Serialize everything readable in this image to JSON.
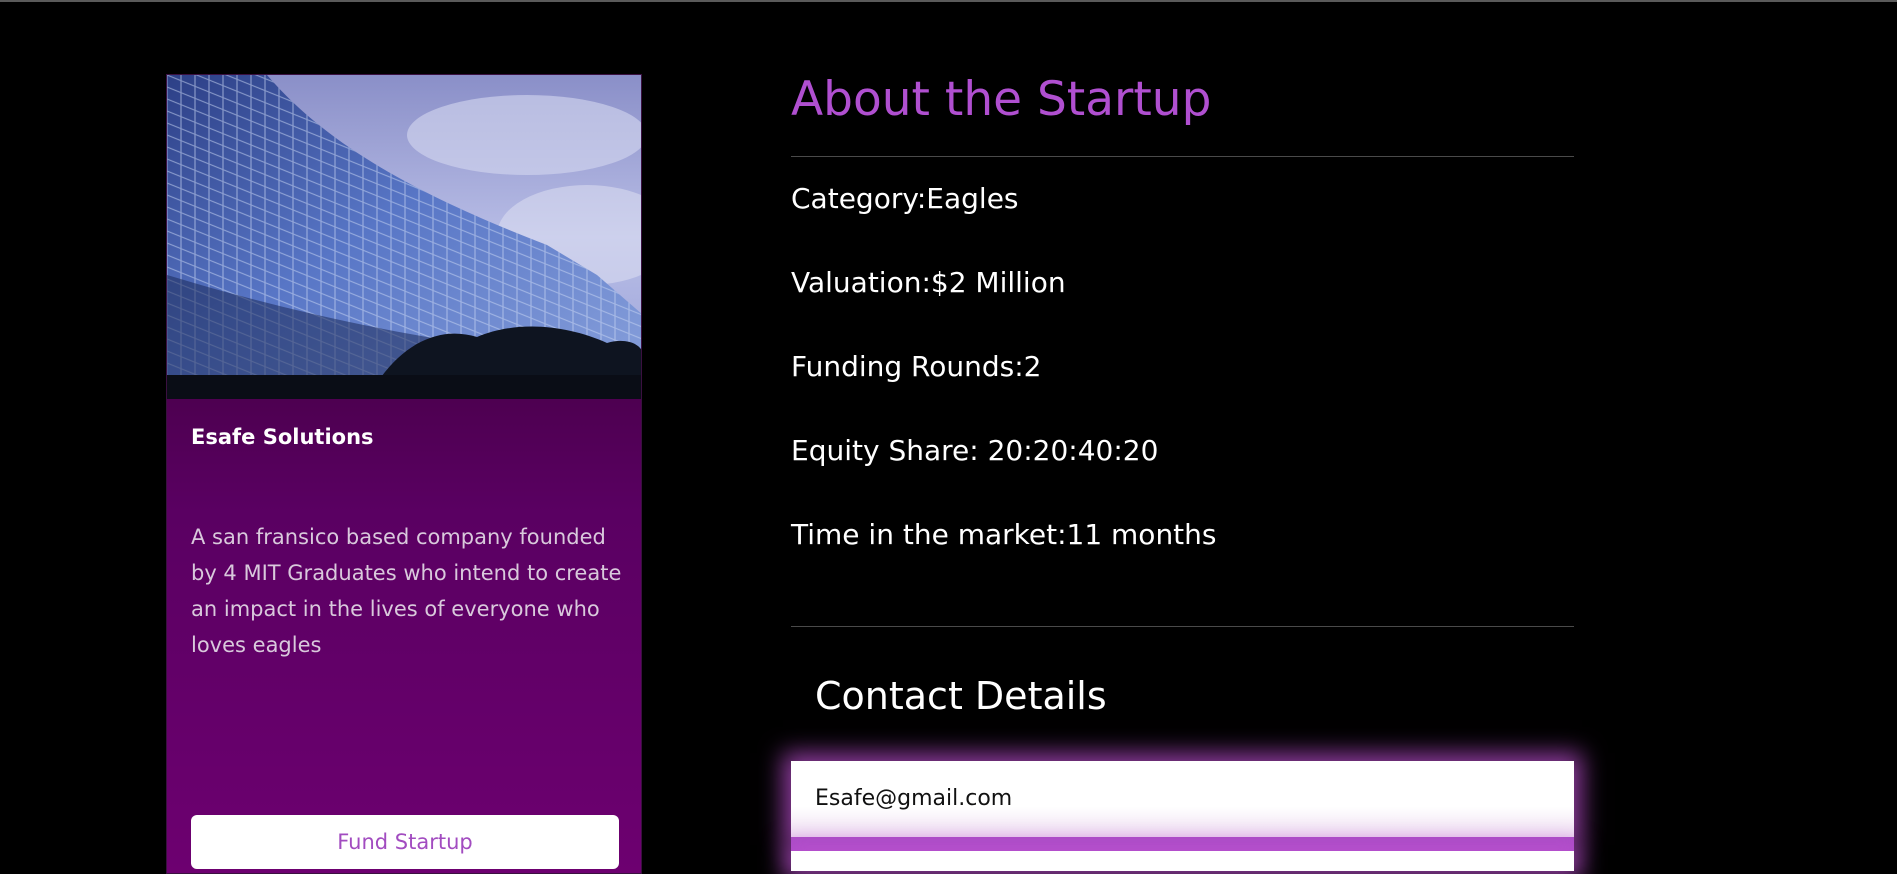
{
  "card": {
    "title": "Esafe Solutions",
    "description": "A san fransico based company founded by 4 MIT Graduates who intend to create an impact in the lives of everyone who loves eagles",
    "fund_button_label": "Fund Startup"
  },
  "about": {
    "title": "About the Startup",
    "category": "Category:Eagles",
    "valuation": "Valuation:$2 Million",
    "funding_rounds": "Funding Rounds:2",
    "equity_share": "Equity Share: 20:20:40:20",
    "time_in_market": "Time in the market:11 months"
  },
  "contact": {
    "title": "Contact Details",
    "email": "Esafe@gmail.com"
  },
  "colors": {
    "background": "#000000",
    "accent": "#b04fd0",
    "card_gradient_top": "#2b0020",
    "card_gradient_bottom": "#6d0070",
    "button_text": "#a24cc0"
  }
}
